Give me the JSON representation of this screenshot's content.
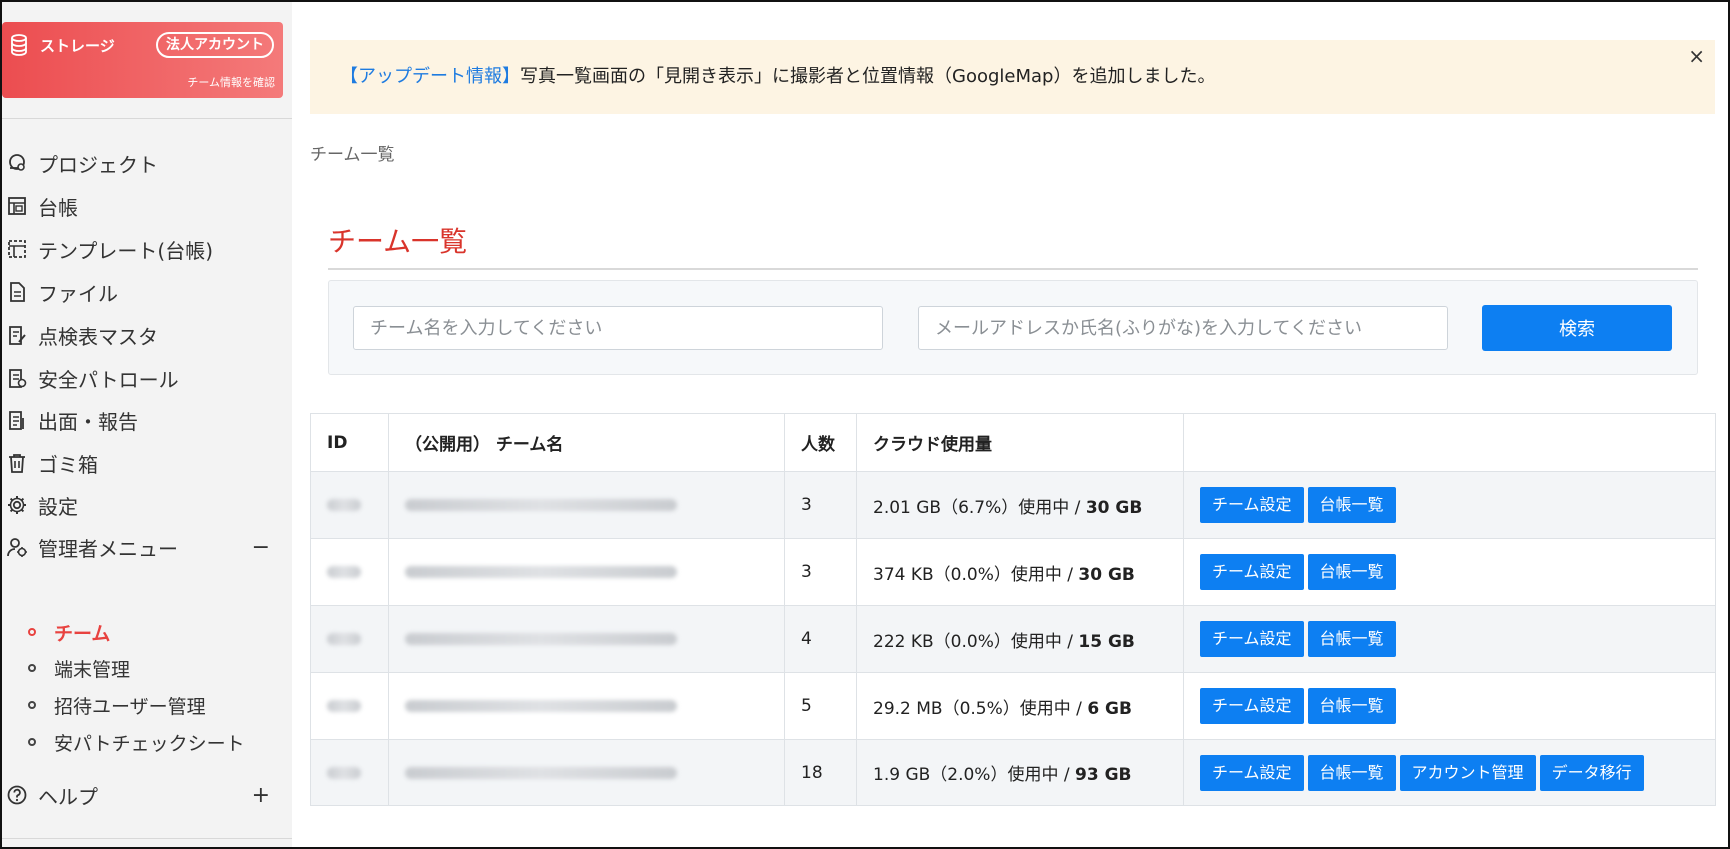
{
  "sidebar": {
    "storage_label": "ストレージ",
    "corp_badge": "法人アカウント",
    "team_info_link": "チーム情報を確認",
    "nav": [
      {
        "label": "プロジェクト",
        "icon": "project-icon"
      },
      {
        "label": "台帳",
        "icon": "ledger-icon"
      },
      {
        "label": "テンプレート(台帳)",
        "icon": "template-icon"
      },
      {
        "label": "ファイル",
        "icon": "file-icon"
      },
      {
        "label": "点検表マスタ",
        "icon": "checklist-icon"
      },
      {
        "label": "安全パトロール",
        "icon": "patrol-icon"
      },
      {
        "label": "出面・報告",
        "icon": "report-icon"
      },
      {
        "label": "ゴミ箱",
        "icon": "trash-icon"
      },
      {
        "label": "設定",
        "icon": "gear-icon"
      },
      {
        "label": "管理者メニュー",
        "icon": "admin-icon",
        "toggle": "−"
      }
    ],
    "admin_sub": [
      {
        "label": "チーム",
        "active": true
      },
      {
        "label": "端末管理",
        "active": false
      },
      {
        "label": "招待ユーザー管理",
        "active": false
      },
      {
        "label": "安パトチェックシート",
        "active": false
      }
    ],
    "help": {
      "label": "ヘルプ",
      "toggle": "+"
    }
  },
  "notice": {
    "tag": "【アップデート情報】",
    "text": "写真一覧画面の「見開き表示」に撮影者と位置情報（GoogleMap）を追加しました。",
    "close": "×"
  },
  "breadcrumb": "チーム一覧",
  "page_title": "チーム一覧",
  "search": {
    "team_placeholder": "チーム名を入力してください",
    "member_placeholder": "メールアドレスか氏名(ふりがな)を入力してください",
    "button": "検索"
  },
  "table": {
    "headers": [
      "ID",
      "（公開用） チーム名",
      "人数",
      "クラウド使用量",
      ""
    ],
    "rows": [
      {
        "members": "3",
        "usage": "2.01 GB（6.7%）使用中 / ",
        "quota": "30 GB",
        "actions": [
          "チーム設定",
          "台帳一覧"
        ]
      },
      {
        "members": "3",
        "usage": "374 KB（0.0%）使用中 / ",
        "quota": "30 GB",
        "actions": [
          "チーム設定",
          "台帳一覧"
        ]
      },
      {
        "members": "4",
        "usage": "222 KB（0.0%）使用中 / ",
        "quota": "15 GB",
        "actions": [
          "チーム設定",
          "台帳一覧"
        ]
      },
      {
        "members": "5",
        "usage": "29.2 MB（0.5%）使用中 / ",
        "quota": "6 GB",
        "actions": [
          "チーム設定",
          "台帳一覧"
        ]
      },
      {
        "members": "18",
        "usage": "1.9 GB（2.0%）使用中 / ",
        "quota": "93 GB",
        "actions": [
          "チーム設定",
          "台帳一覧",
          "アカウント管理",
          "データ移行"
        ]
      }
    ]
  },
  "colors": {
    "accent_red": "#d9342b",
    "primary_blue": "#0d7ff2",
    "notice_bg": "#fdf4e3"
  }
}
